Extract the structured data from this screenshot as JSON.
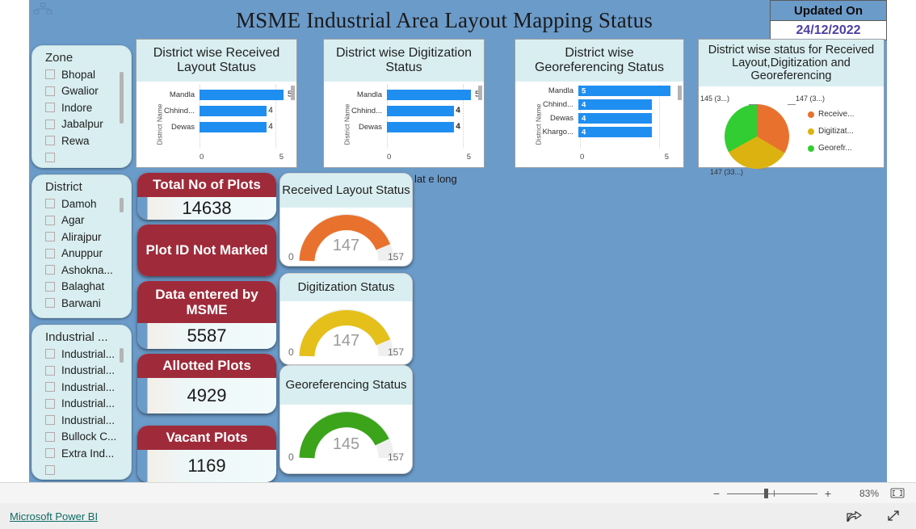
{
  "header": {
    "title": "MSME Industrial Area Layout Mapping Status",
    "updated_label": "Updated On",
    "updated_value": "24/12/2022",
    "corner_icon": "hierarchy-icon"
  },
  "slicers": [
    {
      "id": "zone",
      "title": "Zone",
      "items": [
        "Bhopal",
        "Gwalior",
        "Indore",
        "Jabalpur",
        "Rewa"
      ]
    },
    {
      "id": "district",
      "title": "District",
      "items": [
        "Damoh",
        "Agar",
        "Alirajpur",
        "Anuppur",
        "Ashokna...",
        "Balaghat",
        "Barwani"
      ]
    },
    {
      "id": "industrial-area",
      "title": "Industrial ...",
      "items": [
        "Industrial...",
        "Industrial...",
        "Industrial...",
        "Industrial...",
        "Industrial...",
        "Bullock C...",
        "Extra Ind..."
      ]
    }
  ],
  "kpis": [
    {
      "id": "total-plots",
      "label": "Total No of Plots",
      "value": "14638"
    },
    {
      "id": "plot-id-not-marked",
      "label": "Plot ID Not Marked",
      "value": ""
    },
    {
      "id": "data-entered-by-msme",
      "label": "Data entered by MSME",
      "value": "5587"
    },
    {
      "id": "allotted-plots",
      "label": "Allotted Plots",
      "value": "4929"
    },
    {
      "id": "vacant-plots",
      "label": "Vacant Plots",
      "value": "1169"
    }
  ],
  "gauges": [
    {
      "id": "received-layout-status",
      "title": "Received Layout Status",
      "value": "147",
      "min": "0",
      "max": "157",
      "color": "#e8722d",
      "pct": 93.6
    },
    {
      "id": "digitization-status",
      "title": "Digitization Status",
      "value": "147",
      "min": "0",
      "max": "157",
      "color": "#e5c01b",
      "pct": 93.6
    },
    {
      "id": "georeferencing-status",
      "title": "Georeferencing Status",
      "value": "145",
      "min": "0",
      "max": "157",
      "color": "#3ba41a",
      "pct": 92.4
    }
  ],
  "lat_long_label": "lat e long",
  "chart_data": [
    {
      "id": "district-wise-received-layout",
      "type": "bar",
      "title": "District wise Received Layout Status",
      "orientation": "horizontal",
      "ylabel": "District Name",
      "xlabel": "",
      "categories": [
        "Mandla",
        "Chhind...",
        "Dewas"
      ],
      "values": [
        5,
        4,
        4
      ],
      "xlim": [
        0,
        5
      ],
      "xticks": [
        "0",
        "5"
      ],
      "bar_color": "#1f8ef1",
      "labels_inside": false,
      "grid": true
    },
    {
      "id": "district-wise-digitization",
      "type": "bar",
      "title": "District wise Digitization Status",
      "orientation": "horizontal",
      "ylabel": "District Name",
      "xlabel": "",
      "categories": [
        "Mandla",
        "Chhind...",
        "Dewas"
      ],
      "values": [
        5,
        4,
        4
      ],
      "xlim": [
        0,
        5
      ],
      "xticks": [
        "0",
        "5"
      ],
      "bar_color": "#1f8ef1",
      "labels_inside": false,
      "grid": true
    },
    {
      "id": "district-wise-georeferencing",
      "type": "bar",
      "title": "District wise Georeferencing Status",
      "orientation": "horizontal",
      "ylabel": "District Name",
      "xlabel": "",
      "categories": [
        "Mandla",
        "Chhind...",
        "Dewas",
        "Khargo..."
      ],
      "values": [
        5,
        4,
        4,
        4
      ],
      "xlim": [
        0,
        5
      ],
      "xticks": [
        "0",
        "5"
      ],
      "bar_color": "#1f8ef1",
      "labels_inside": true,
      "grid": true
    },
    {
      "id": "district-wise-status-pie",
      "type": "pie",
      "title": "District wise status for Received Layout,Digitization and Georeferencing",
      "slices": [
        {
          "name": "Receive...",
          "value": 147,
          "label": "147 (3...)",
          "color": "#e8722d"
        },
        {
          "name": "Digitizat...",
          "value": 147,
          "label": "147 (33...)",
          "color": "#dcb211"
        },
        {
          "name": "Georefr...",
          "value": 145,
          "label": "145 (3...)",
          "color": "#32cd32"
        }
      ],
      "legend_position": "right"
    }
  ],
  "statusbar": {
    "zoom_out": "−",
    "zoom_in": "+",
    "zoom_percent": "83%",
    "fit_icon": "fit-to-page-icon"
  },
  "footer": {
    "link_label": "Microsoft Power BI",
    "share_icon": "share-icon",
    "fullscreen_icon": "fullscreen-icon"
  }
}
